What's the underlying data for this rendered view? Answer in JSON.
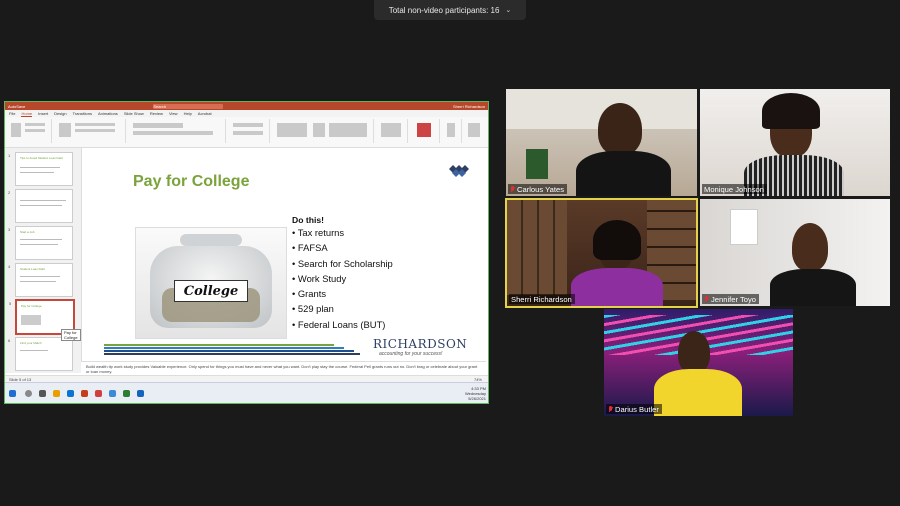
{
  "meeting": {
    "participants_banner": "Total non-video participants: 16",
    "chevron_icon": "chevron-down-icon"
  },
  "powerpoint": {
    "title_bar": {
      "autosave": "AutoSave",
      "search": "Search",
      "user": "Sherri Richardson"
    },
    "menu": [
      "File",
      "Home",
      "Insert",
      "Design",
      "Transitions",
      "Animations",
      "Slide Show",
      "Review",
      "View",
      "Help",
      "Acrobat"
    ],
    "active_menu": "Home",
    "thumbnails": [
      {
        "num": "1",
        "title": "Tips to Avoid Student Loan Debt"
      },
      {
        "num": "2",
        "title": ""
      },
      {
        "num": "3",
        "title": "Start a Job"
      },
      {
        "num": "4",
        "title": "Student Loan Debt"
      },
      {
        "num": "5",
        "title": "Pay for College"
      },
      {
        "num": "6",
        "title": "Find your Match"
      }
    ],
    "tooltip": "Pay for College",
    "slide": {
      "title": "Pay for College",
      "jar_label": "College",
      "list_heading": "Do this!",
      "items": [
        "Tax returns",
        "FAFSA",
        "Search for Scholarship",
        "Work Study",
        "Grants",
        "529 plan",
        "Federal Loans (BUT)"
      ],
      "logo_name": "RICHARDSON",
      "logo_tagline": "accounting for your success!"
    },
    "notes": "Build wealth tip work study provides Valuable experience. Only spend for things you must have and never what you want. Don't play stay the course. Federal Pell grants runs out no. Don't brag or celebrate about your grant or loan money.",
    "status": {
      "slide_count": "Slide 5 of 13",
      "zoom": "74%"
    },
    "clock": {
      "time": "4:33 PM",
      "day": "Wednesday",
      "date": "5/26/2021"
    },
    "colors": {
      "accent": "#b7472a",
      "title_green": "#7aa33b",
      "logo_blue": "#2d3f62"
    }
  },
  "participants": [
    {
      "name": "Carlous Yates",
      "muted": true
    },
    {
      "name": "Monique Johnson",
      "muted": false
    },
    {
      "name": "Sherri Richardson",
      "muted": false,
      "active_speaker": true
    },
    {
      "name": "Jennifer Toyo",
      "muted": true
    },
    {
      "name": "Darius Butler",
      "muted": true
    }
  ]
}
